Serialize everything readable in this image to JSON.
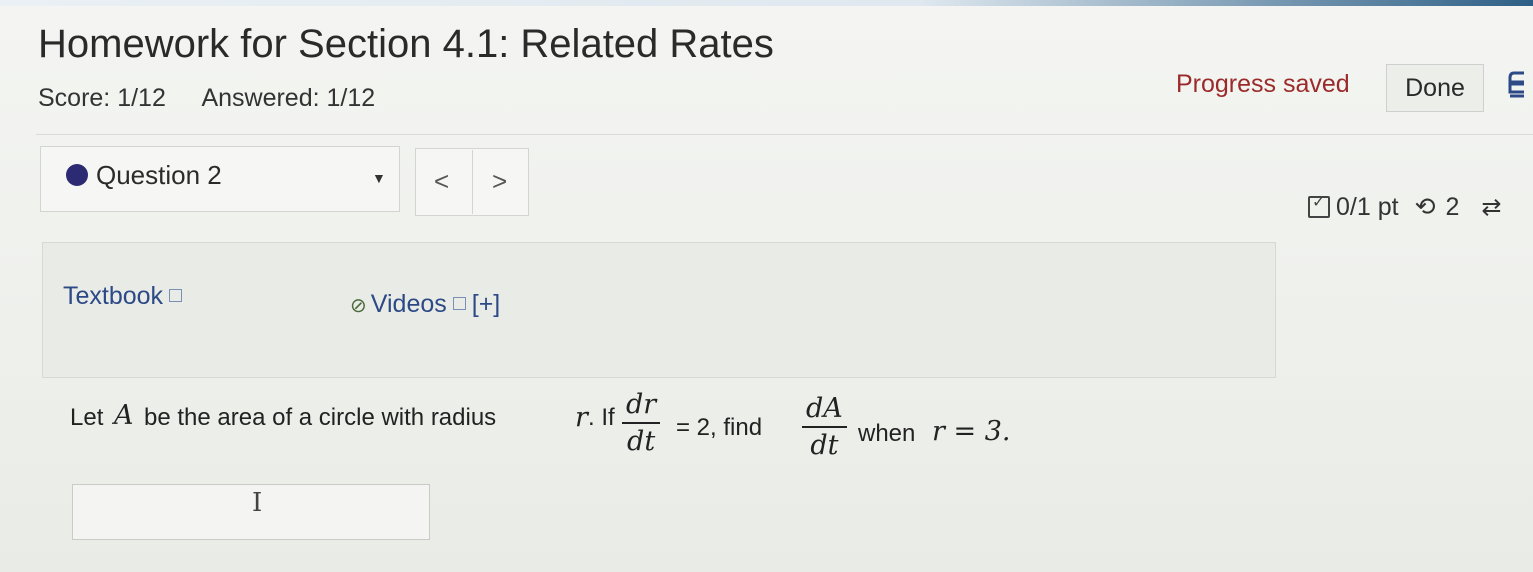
{
  "header": {
    "title": "Homework for Section 4.1: Related Rates",
    "score": "Score: 1/12",
    "answered": "Answered: 1/12",
    "progress_status": "Progress saved",
    "done_label": "Done"
  },
  "question_nav": {
    "selected": "Question 2",
    "prev": "<",
    "next": ">"
  },
  "points": {
    "score": "0/1 pt",
    "tries_left": "2"
  },
  "resources": {
    "textbook": "Textbook",
    "videos": "Videos",
    "expand": "[+]"
  },
  "question": {
    "part1": "Let",
    "varA": "A",
    "part2": "be the area of a circle with radius",
    "varR": "r",
    "part3": ". If",
    "frac1_num": "dr",
    "frac1_den": "dt",
    "part4": "= 2, find",
    "frac2_num": "dA",
    "frac2_den": "dt",
    "part5": "when",
    "cond": "r = 3."
  },
  "colors": {
    "saved_text": "#9b2b2b",
    "link": "#2d4a86",
    "question_dot": "#2c2a73"
  },
  "icons": [
    "print-icon",
    "external-link-icon",
    "paperclip-icon",
    "checkbox-icon",
    "retry-icon",
    "cycle-icon",
    "chevron-down-icon"
  ]
}
